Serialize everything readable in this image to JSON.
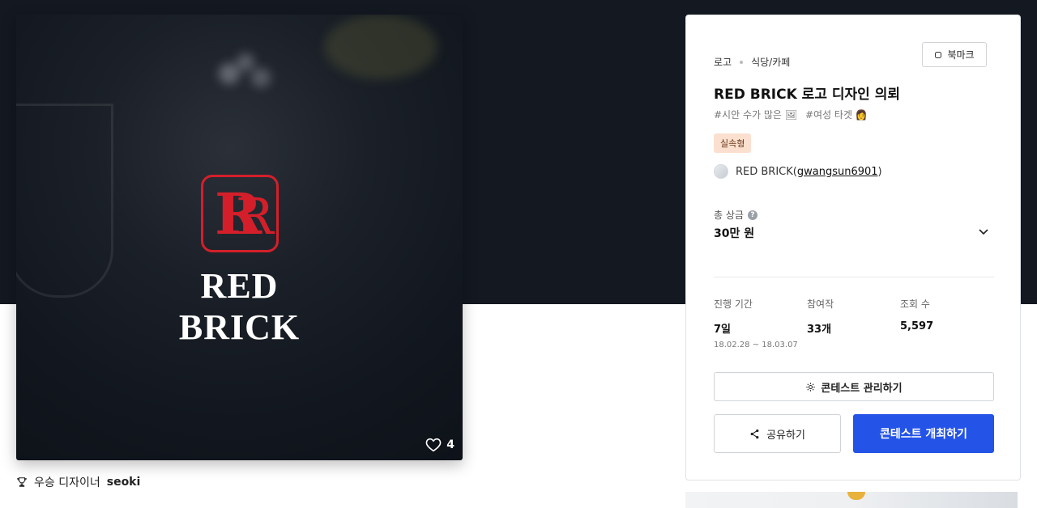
{
  "hero": {
    "logo_text": "RED BRICK",
    "like_count": "4"
  },
  "winner": {
    "label": "우승 디자이너",
    "name": "seoki"
  },
  "card": {
    "breadcrumb": [
      "로고",
      "식당/카페"
    ],
    "bookmark_label": "북마크",
    "title": "RED BRICK 로고 디자인 의뢰",
    "tags": [
      "#시안 수가 많은 🖼",
      "#여성 타겟 👩"
    ],
    "badge": "실속형",
    "client_name": "RED BRICK",
    "client_id": "gwangsun6901",
    "prize_label": "총 상금",
    "prize_value": "30만 원",
    "stats": {
      "period_label": "진행 기간",
      "period_value": "7일",
      "period_range": "18.02.28 ~ 18.03.07",
      "entries_label": "참여작",
      "entries_value": "33개",
      "views_label": "조회 수",
      "views_value": "5,597"
    },
    "manage_button": "콘테스트 관리하기",
    "share_button": "공유하기",
    "host_button": "콘테스트 개최하기"
  },
  "colors": {
    "brand_red": "#d41f2a",
    "primary_blue": "#2453e8",
    "dark_band": "#131821"
  }
}
